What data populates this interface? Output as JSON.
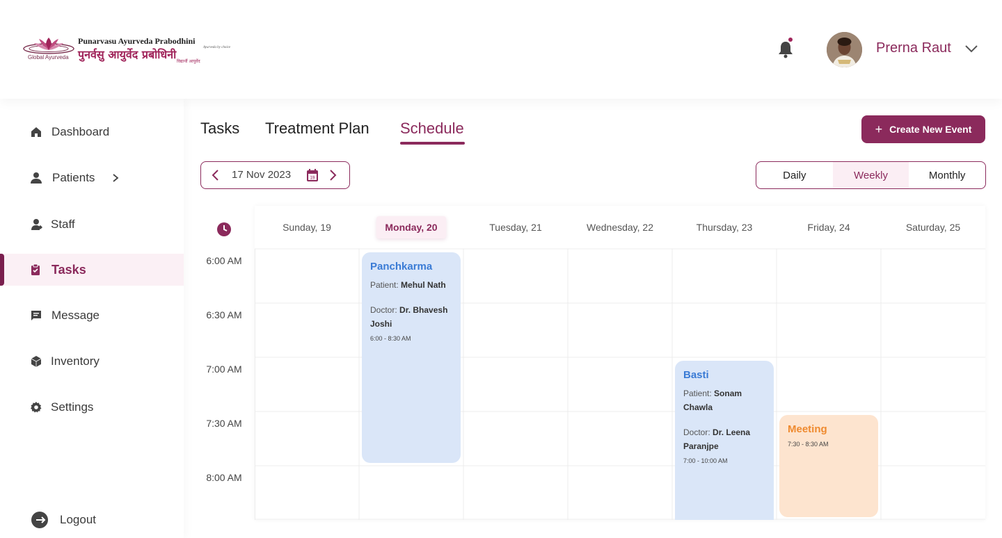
{
  "brand": {
    "name_en": "Punarvasu Ayurveda Prabodhini",
    "name_hi": "पुनर्वसु आयुर्वेद प्रबोधिनी",
    "tagline": "Ayurveda by choice",
    "sub": "Global Ayurveda",
    "tag_hi": "विद्यार्थी आयुर्वेद"
  },
  "header": {
    "user_name": "Prerna Raut",
    "has_notification": true
  },
  "sidebar": {
    "items": [
      {
        "label": "Dashboard",
        "icon": "home-icon"
      },
      {
        "label": "Patients",
        "icon": "user-icon",
        "has_submenu": true
      },
      {
        "label": "Staff",
        "icon": "staff-icon"
      },
      {
        "label": "Tasks",
        "icon": "clipboard-icon",
        "active": true
      },
      {
        "label": "Message",
        "icon": "message-icon"
      },
      {
        "label": "Inventory",
        "icon": "box-icon"
      },
      {
        "label": "Settings",
        "icon": "gear-icon"
      }
    ],
    "logout_label": "Logout"
  },
  "tabs": [
    {
      "label": "Tasks"
    },
    {
      "label": "Treatment Plan"
    },
    {
      "label": "Schedule",
      "active": true
    }
  ],
  "create_button_label": "Create New Event",
  "date_nav": {
    "date": "17 Nov 2023",
    "calendar_day": "19"
  },
  "views": {
    "daily": "Daily",
    "weekly": "Weekly",
    "monthly": "Monthly",
    "selected": "Weekly"
  },
  "calendar": {
    "days": [
      "Sunday, 19",
      "Monday, 20",
      "Tuesday, 21",
      "Wednesday, 22",
      "Thursday, 23",
      "Friday, 24",
      "Saturday, 25"
    ],
    "today_index": 1,
    "times": [
      "6:00 AM",
      "6:30 AM",
      "7:00 AM",
      "7:30 AM",
      "8:00 AM"
    ],
    "events": [
      {
        "title": "Panchkarma",
        "patient_label": "Patient:",
        "patient": "Mehul Nath",
        "doctor_label": "Doctor:",
        "doctor": "Dr. Bhavesh Joshi",
        "time": "6:00 - 8:30 AM",
        "color": "#dae6f8",
        "title_color": "#3a7bd5"
      },
      {
        "title": "Basti",
        "patient_label": "Patient:",
        "patient": "Sonam Chawla",
        "doctor_label": "Doctor:",
        "doctor": "Dr. Leena Paranjpe",
        "time": "7:00 - 10:00 AM",
        "color": "#dae6f8",
        "title_color": "#3a7bd5"
      },
      {
        "title": "Meeting",
        "time": "7:30 - 8:30 AM",
        "color": "#fde4cf",
        "title_color": "#ef8a2f"
      }
    ]
  },
  "colors": {
    "accent": "#8b2a5c",
    "accent_light": "#fbeef4"
  }
}
